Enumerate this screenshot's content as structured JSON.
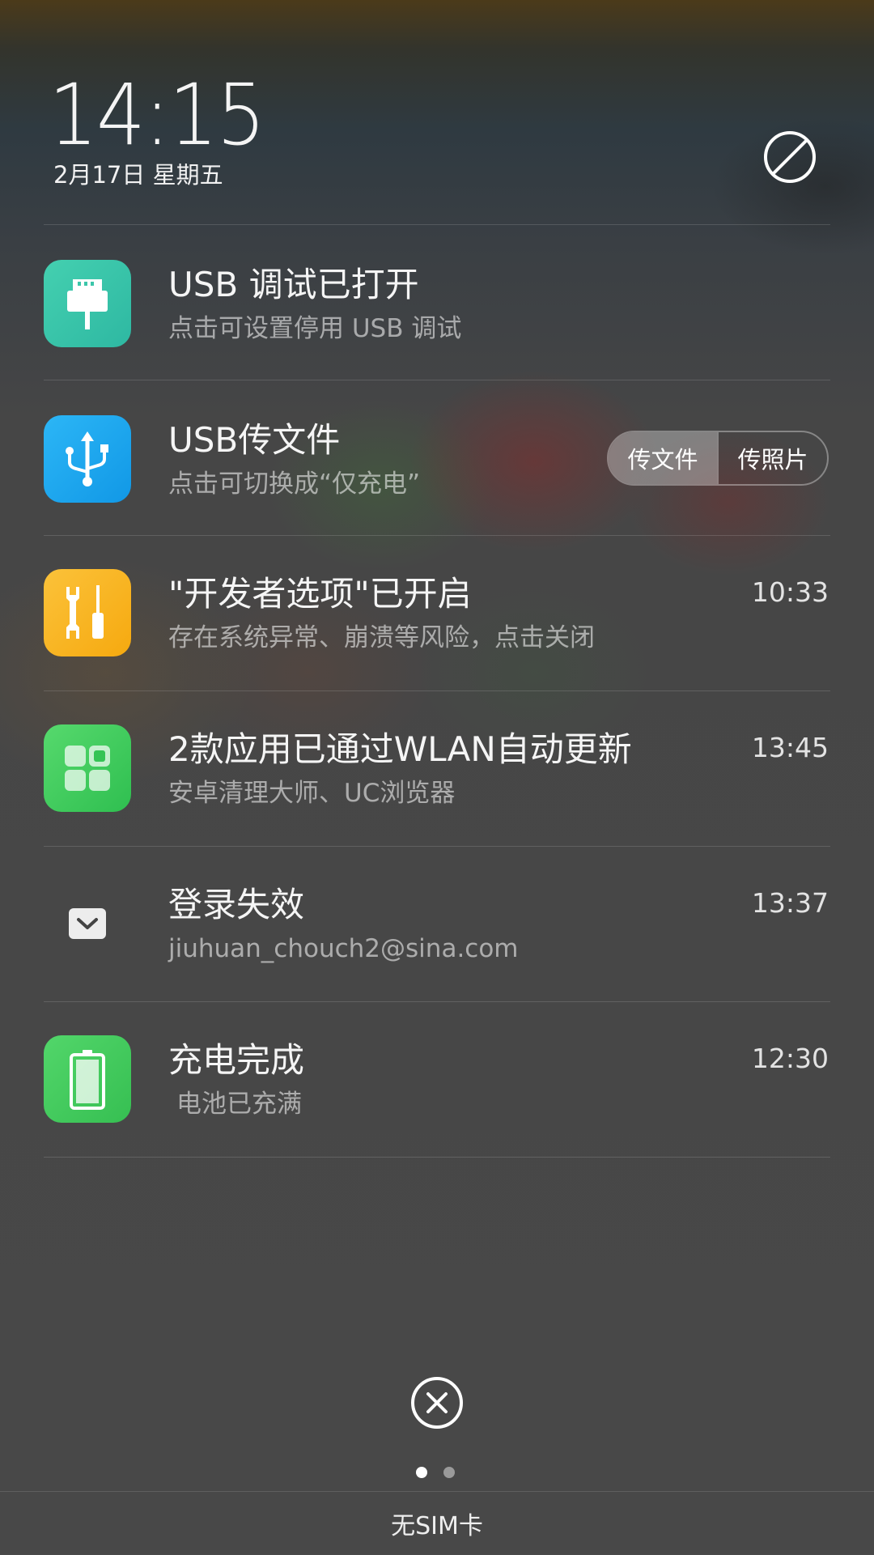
{
  "header": {
    "time": "14:15",
    "date": "2月17日 星期五",
    "dnd_icon": "do-not-disturb-icon"
  },
  "notifications": [
    {
      "title": "USB 调试已打开",
      "subtitle": "点击可设置停用 USB 调试",
      "time": "",
      "icon": "usb-plug-icon",
      "icon_color": "#35C4A6"
    },
    {
      "title": "USB传文件",
      "subtitle": "点击可切换成“仅充电”",
      "time": "",
      "icon": "usb-symbol-icon",
      "icon_color": "#1AA7F0",
      "segments": {
        "option1": "传文件",
        "option2": "传照片",
        "selected": "传文件"
      }
    },
    {
      "title": "\"开发者选项\"已开启",
      "subtitle": "存在系统异常、崩溃等风险，点击关闭",
      "time": "10:33",
      "icon": "developer-tools-icon",
      "icon_color": "#F9B422"
    },
    {
      "title": "2款应用已通过WLAN自动更新",
      "subtitle": "安卓清理大师、UC浏览器",
      "time": "13:45",
      "icon": "app-store-icon",
      "icon_color": "#3DCB5B"
    },
    {
      "title": "登录失效",
      "subtitle": "jiuhuan_chouch2@sina.com",
      "time": "13:37",
      "icon": "mail-icon",
      "icon_color": "#EDEDED"
    },
    {
      "title": "充电完成",
      "subtitle": "电池已充满",
      "time": "12:30",
      "icon": "battery-full-icon",
      "icon_color": "#42C75A"
    }
  ],
  "footer": {
    "clear_icon": "clear-all-icon",
    "page_count": 2,
    "active_page": 1,
    "sim_status": "无SIM卡"
  }
}
